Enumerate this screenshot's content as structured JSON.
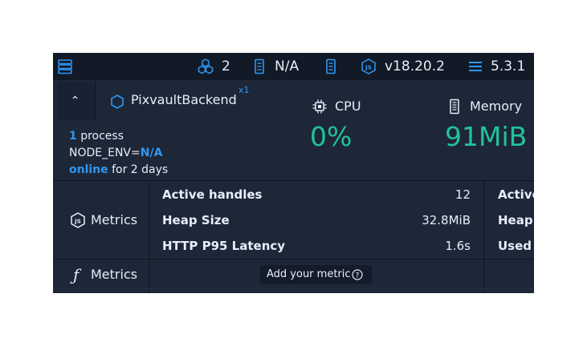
{
  "topbar": {
    "cluster_count": "2",
    "env_value": "N/A",
    "node_version": "v18.20.2",
    "pm2_version": "5.3.1"
  },
  "app": {
    "name": "PixvaultBackend",
    "instances": "x1",
    "process_count": "1",
    "process_word": " process",
    "env_key": "NODE_ENV=",
    "env_value": "N/A",
    "status": "online",
    "uptime": " for 2 days"
  },
  "stats": {
    "cpu_label": "CPU",
    "cpu_value": "0%",
    "memory_label": "Memory",
    "memory_value": "91MiB"
  },
  "node_metrics": {
    "section_label": "Metrics",
    "rows": [
      {
        "label": "Active handles",
        "value": "12"
      },
      {
        "label": "Heap Size",
        "value": "32.8MiB"
      },
      {
        "label": "HTTP P95 Latency",
        "value": "1.6s"
      }
    ],
    "right_rows": [
      "Active",
      "Heap U",
      "Used H"
    ]
  },
  "custom_metrics": {
    "section_label": "Metrics",
    "add_label": "Add your metric"
  },
  "colors": {
    "accent_blue": "#2f97f3",
    "value_green": "#21c39a",
    "panel_bg": "#1d2738"
  }
}
